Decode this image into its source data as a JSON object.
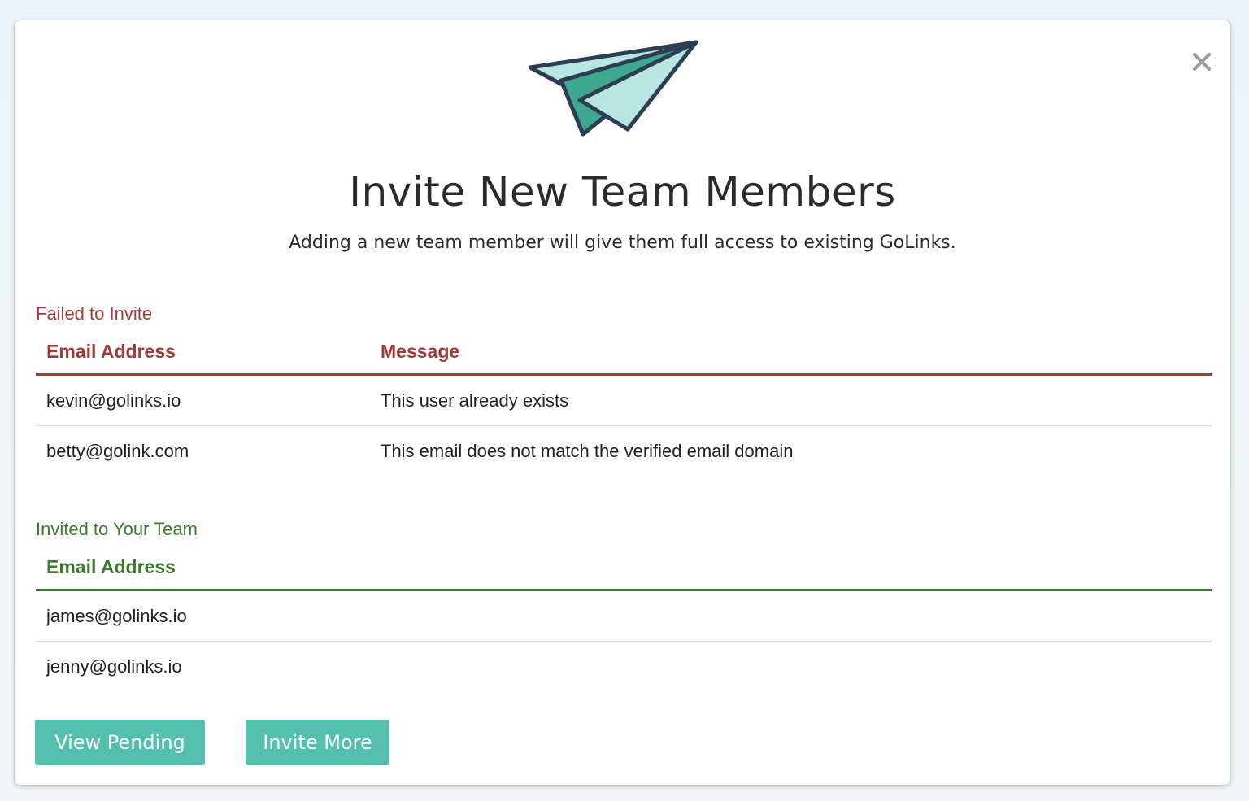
{
  "modal": {
    "title": "Invite New Team Members",
    "subtitle": "Adding a new team member will give them full access to existing GoLinks.",
    "close_icon": "close-icon"
  },
  "failed": {
    "label": "Failed to Invite",
    "columns": [
      "Email Address",
      "Message"
    ],
    "rows": [
      {
        "email": "kevin@golinks.io",
        "message": "This user already exists"
      },
      {
        "email": "betty@golink.com",
        "message": "This email does not match the verified email domain"
      }
    ],
    "color": "#a33a3a"
  },
  "invited": {
    "label": "Invited to Your Team",
    "columns": [
      "Email Address"
    ],
    "rows": [
      {
        "email": "james@golinks.io"
      },
      {
        "email": "jenny@golinks.io"
      }
    ],
    "color": "#3d7a30"
  },
  "buttons": {
    "view_pending": "View Pending",
    "invite_more": "Invite More",
    "color": "#55bfad"
  },
  "icons": {
    "illustration": "paper-plane-icon"
  }
}
